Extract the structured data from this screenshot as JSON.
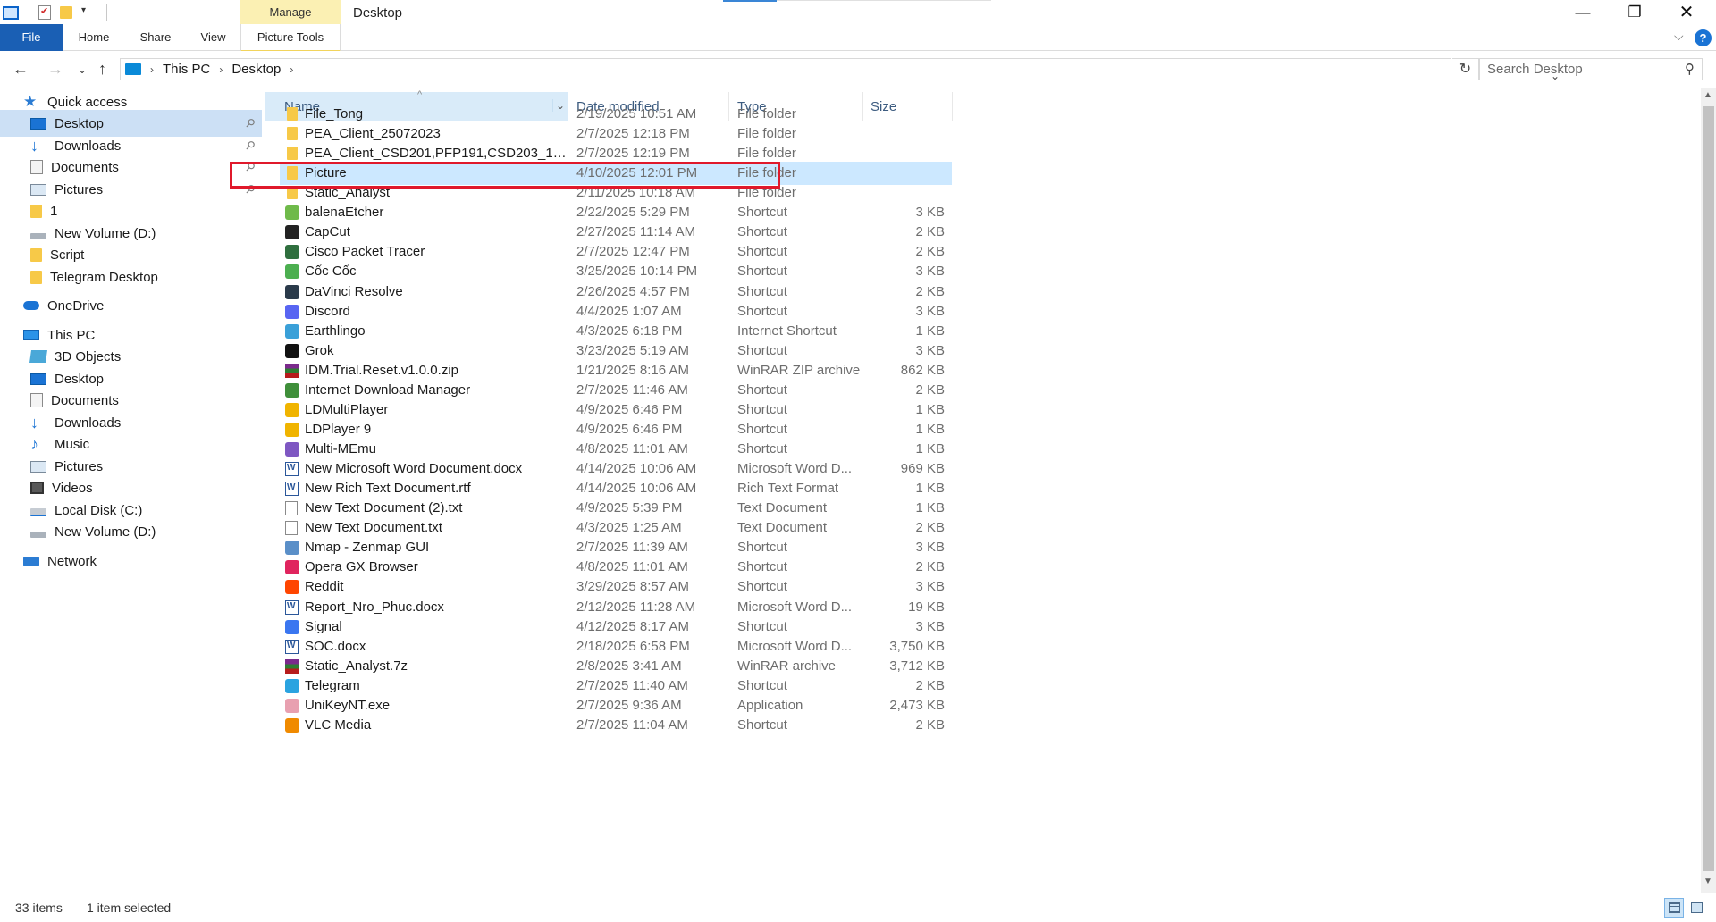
{
  "window": {
    "manage_tab": "Manage",
    "title": "Desktop",
    "minimize_glyph": "—",
    "maximize_glyph": "❐",
    "close_glyph": "✕"
  },
  "ribbon": {
    "tabs": [
      "File",
      "Home",
      "Share",
      "View",
      "Picture Tools"
    ],
    "help_glyph": "?",
    "collapse_glyph": "⌵"
  },
  "nav": {
    "back_glyph": "←",
    "forward_glyph": "→",
    "recent_glyph": "⌄",
    "up_glyph": "↑",
    "breadcrumb": [
      "This PC",
      "Desktop"
    ],
    "separator": "›",
    "refresh_glyph": "↻",
    "search_placeholder": "Search Desktop",
    "search_glyph": "⚲"
  },
  "sidebar": {
    "items": [
      {
        "label": "Quick access",
        "icon": "star-icon",
        "indent": 1
      },
      {
        "label": "Desktop",
        "icon": "desktop-icon",
        "indent": 2,
        "pinned": true,
        "selected": true
      },
      {
        "label": "Downloads",
        "icon": "download-icon",
        "indent": 2,
        "pinned": true
      },
      {
        "label": "Documents",
        "icon": "document-icon",
        "indent": 2,
        "pinned": true
      },
      {
        "label": "Pictures",
        "icon": "pictures-icon",
        "indent": 2,
        "pinned": true
      },
      {
        "label": "1",
        "icon": "folder-icon",
        "indent": 2
      },
      {
        "label": "New Volume (D:)",
        "icon": "drive-icon",
        "indent": 2
      },
      {
        "label": "Script",
        "icon": "folder-icon",
        "indent": 2
      },
      {
        "label": "Telegram Desktop",
        "icon": "folder-icon",
        "indent": 2
      },
      {
        "label": "OneDrive",
        "icon": "cloud-icon",
        "indent": 1
      },
      {
        "label": "This PC",
        "icon": "pc-icon",
        "indent": 1
      },
      {
        "label": "3D Objects",
        "icon": "objects-3d-icon",
        "indent": 2
      },
      {
        "label": "Desktop",
        "icon": "desktop-icon",
        "indent": 2
      },
      {
        "label": "Documents",
        "icon": "document-icon",
        "indent": 2
      },
      {
        "label": "Downloads",
        "icon": "download-icon",
        "indent": 2
      },
      {
        "label": "Music",
        "icon": "music-icon",
        "indent": 2
      },
      {
        "label": "Pictures",
        "icon": "pictures-icon",
        "indent": 2
      },
      {
        "label": "Videos",
        "icon": "video-icon",
        "indent": 2
      },
      {
        "label": "Local Disk (C:)",
        "icon": "local-disk-icon",
        "indent": 2
      },
      {
        "label": "New Volume (D:)",
        "icon": "drive-icon",
        "indent": 2
      },
      {
        "label": "Network",
        "icon": "network-icon",
        "indent": 1
      }
    ],
    "pin_glyph": "📌"
  },
  "columns": {
    "name": "Name",
    "date": "Date modified",
    "type": "Type",
    "size": "Size",
    "sort_glyph": "^",
    "drop_glyph": "⌄"
  },
  "files": [
    {
      "name": "File_Tong",
      "date": "2/19/2025 10:51 AM",
      "type": "File folder",
      "size": "",
      "icon": "folder-icon",
      "color": "#f7c948"
    },
    {
      "name": "PEA_Client_25072023",
      "date": "2/7/2025 12:18 PM",
      "type": "File folder",
      "size": "",
      "icon": "folder-icon",
      "color": "#f7c948"
    },
    {
      "name": "PEA_Client_CSD201,PFP191,CSD203_1906...",
      "date": "2/7/2025 12:19 PM",
      "type": "File folder",
      "size": "",
      "icon": "folder-icon",
      "color": "#f7c948"
    },
    {
      "name": "Picture",
      "date": "4/10/2025 12:01 PM",
      "type": "File folder",
      "size": "",
      "icon": "folder-icon",
      "color": "#f7c948",
      "selected": true
    },
    {
      "name": "Static_Analyst",
      "date": "2/11/2025 10:18 AM",
      "type": "File folder",
      "size": "",
      "icon": "folder-icon",
      "color": "#f7c948"
    },
    {
      "name": "balenaEtcher",
      "date": "2/22/2025 5:29 PM",
      "type": "Shortcut",
      "size": "3 KB",
      "icon": "balena-etcher-icon",
      "color": "#6fba4a"
    },
    {
      "name": "CapCut",
      "date": "2/27/2025 11:14 AM",
      "type": "Shortcut",
      "size": "2 KB",
      "icon": "capcut-icon",
      "color": "#222222"
    },
    {
      "name": "Cisco Packet Tracer",
      "date": "2/7/2025 12:47 PM",
      "type": "Shortcut",
      "size": "2 KB",
      "icon": "cisco-icon",
      "color": "#2f6f3e"
    },
    {
      "name": "Cốc Cốc",
      "date": "3/25/2025 10:14 PM",
      "type": "Shortcut",
      "size": "3 KB",
      "icon": "coccoc-icon",
      "color": "#4caf50"
    },
    {
      "name": "DaVinci Resolve",
      "date": "2/26/2025 4:57 PM",
      "type": "Shortcut",
      "size": "2 KB",
      "icon": "davinci-icon",
      "color": "#2a3a4a"
    },
    {
      "name": "Discord",
      "date": "4/4/2025 1:07 AM",
      "type": "Shortcut",
      "size": "3 KB",
      "icon": "discord-icon",
      "color": "#5865f2"
    },
    {
      "name": "Earthlingo",
      "date": "4/3/2025 6:18 PM",
      "type": "Internet Shortcut",
      "size": "1 KB",
      "icon": "earthlingo-icon",
      "color": "#3aa0d8"
    },
    {
      "name": "Grok",
      "date": "3/23/2025 5:19 AM",
      "type": "Shortcut",
      "size": "3 KB",
      "icon": "grok-icon",
      "color": "#111111"
    },
    {
      "name": "IDM.Trial.Reset.v1.0.0.zip",
      "date": "1/21/2025 8:16 AM",
      "type": "WinRAR ZIP archive",
      "size": "862 KB",
      "icon": "winrar-icon",
      "color": "#7b2a8c"
    },
    {
      "name": "Internet Download Manager",
      "date": "2/7/2025 11:46 AM",
      "type": "Shortcut",
      "size": "2 KB",
      "icon": "idm-icon",
      "color": "#3f8f3a"
    },
    {
      "name": "LDMultiPlayer",
      "date": "4/9/2025 6:46 PM",
      "type": "Shortcut",
      "size": "1 KB",
      "icon": "ldmultiplayer-icon",
      "color": "#f0b400"
    },
    {
      "name": "LDPlayer 9",
      "date": "4/9/2025 6:46 PM",
      "type": "Shortcut",
      "size": "1 KB",
      "icon": "ldplayer-icon",
      "color": "#f0b400"
    },
    {
      "name": "Multi-MEmu",
      "date": "4/8/2025 11:01 AM",
      "type": "Shortcut",
      "size": "1 KB",
      "icon": "memu-icon",
      "color": "#7e57c2"
    },
    {
      "name": "New Microsoft Word Document.docx",
      "date": "4/14/2025 10:06 AM",
      "type": "Microsoft Word D...",
      "size": "969 KB",
      "icon": "word-icon",
      "color": "#2b579a"
    },
    {
      "name": "New Rich Text Document.rtf",
      "date": "4/14/2025 10:06 AM",
      "type": "Rich Text Format",
      "size": "1 KB",
      "icon": "word-icon",
      "color": "#2b579a"
    },
    {
      "name": "New Text Document (2).txt",
      "date": "4/9/2025 5:39 PM",
      "type": "Text Document",
      "size": "1 KB",
      "icon": "text-file-icon",
      "color": "#ffffff"
    },
    {
      "name": "New Text Document.txt",
      "date": "4/3/2025 1:25 AM",
      "type": "Text Document",
      "size": "2 KB",
      "icon": "text-file-icon",
      "color": "#ffffff"
    },
    {
      "name": "Nmap - Zenmap GUI",
      "date": "2/7/2025 11:39 AM",
      "type": "Shortcut",
      "size": "3 KB",
      "icon": "zenmap-icon",
      "color": "#5a8fc8"
    },
    {
      "name": "Opera GX Browser",
      "date": "4/8/2025 11:01 AM",
      "type": "Shortcut",
      "size": "2 KB",
      "icon": "opera-gx-icon",
      "color": "#e0245e"
    },
    {
      "name": "Reddit",
      "date": "3/29/2025 8:57 AM",
      "type": "Shortcut",
      "size": "3 KB",
      "icon": "reddit-icon",
      "color": "#ff4500"
    },
    {
      "name": "Report_Nro_Phuc.docx",
      "date": "2/12/2025 11:28 AM",
      "type": "Microsoft Word D...",
      "size": "19 KB",
      "icon": "word-icon",
      "color": "#2b579a"
    },
    {
      "name": "Signal",
      "date": "4/12/2025 8:17 AM",
      "type": "Shortcut",
      "size": "3 KB",
      "icon": "signal-icon",
      "color": "#3a76f0"
    },
    {
      "name": "SOC.docx",
      "date": "2/18/2025 6:58 PM",
      "type": "Microsoft Word D...",
      "size": "3,750 KB",
      "icon": "word-icon",
      "color": "#2b579a"
    },
    {
      "name": "Static_Analyst.7z",
      "date": "2/8/2025 3:41 AM",
      "type": "WinRAR archive",
      "size": "3,712 KB",
      "icon": "winrar-icon",
      "color": "#7b2a8c"
    },
    {
      "name": "Telegram",
      "date": "2/7/2025 11:40 AM",
      "type": "Shortcut",
      "size": "2 KB",
      "icon": "telegram-icon",
      "color": "#2aa3e0"
    },
    {
      "name": "UniKeyNT.exe",
      "date": "2/7/2025 9:36 AM",
      "type": "Application",
      "size": "2,473 KB",
      "icon": "unikey-icon",
      "color": "#e8a0b0"
    },
    {
      "name": "VLC Media",
      "date": "2/7/2025 11:04 AM",
      "type": "Shortcut",
      "size": "2 KB",
      "icon": "vlc-icon",
      "color": "#f08a00"
    }
  ],
  "scrollbar": {
    "up_glyph": "▲",
    "down_glyph": "▼"
  },
  "status": {
    "item_count": "33 items",
    "selection": "1 item selected"
  }
}
